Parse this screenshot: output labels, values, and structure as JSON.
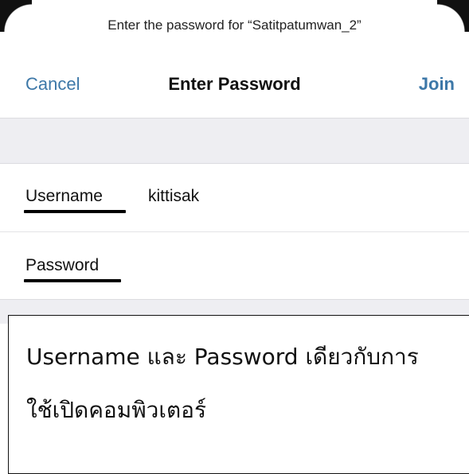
{
  "dialog": {
    "prompt": "Enter the password for “Satitpatumwan_2”",
    "cancel_label": "Cancel",
    "title": "Enter Password",
    "join_label": "Join"
  },
  "form": {
    "username_label": "Username",
    "username_value": "kittisak",
    "password_label": "Password",
    "password_value": ""
  },
  "note": {
    "line1": "Username และ Password เดียวกับการ",
    "line2": "ใช้เปิดคอมพิวเตอร์"
  },
  "colors": {
    "accent": "#3d78a8",
    "band": "#eeeef2"
  }
}
